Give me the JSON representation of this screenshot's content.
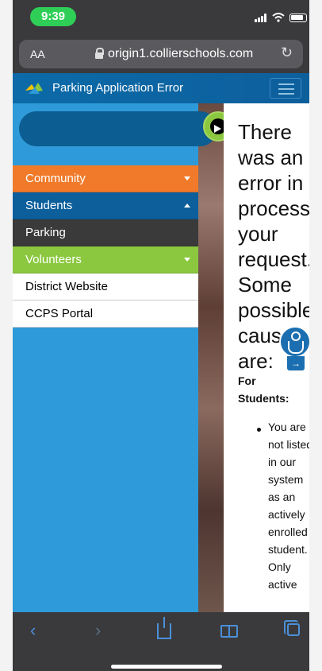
{
  "status_bar": {
    "time": "9:39"
  },
  "browser": {
    "aa_label": "AA",
    "url": "origin1.collierschools.com",
    "reload_icon": "reload-icon"
  },
  "header": {
    "title": "Parking Application Error"
  },
  "sidebar": {
    "items": [
      {
        "label": "Community"
      },
      {
        "label": "Students"
      },
      {
        "label": "Parking"
      },
      {
        "label": "Volunteers"
      },
      {
        "label": "District Website"
      },
      {
        "label": "CCPS Portal"
      }
    ]
  },
  "error": {
    "heading": "There was an error in processing your request. Some possible causes are:",
    "group_title": "For Students:",
    "bullet": "You are not listed in our system as an actively enrolled student. Only active"
  },
  "toolbar": {
    "icons": [
      "back-icon",
      "forward-icon",
      "share-icon",
      "bookmarks-icon",
      "tabs-icon"
    ]
  },
  "colors": {
    "community": "#f07a2a",
    "students": "#0d5f9c",
    "parking": "#3a3a3a",
    "volunteers": "#8bc83f",
    "sidebar_bg": "#2e9ad9",
    "header_bg": "#0c6aa8"
  }
}
